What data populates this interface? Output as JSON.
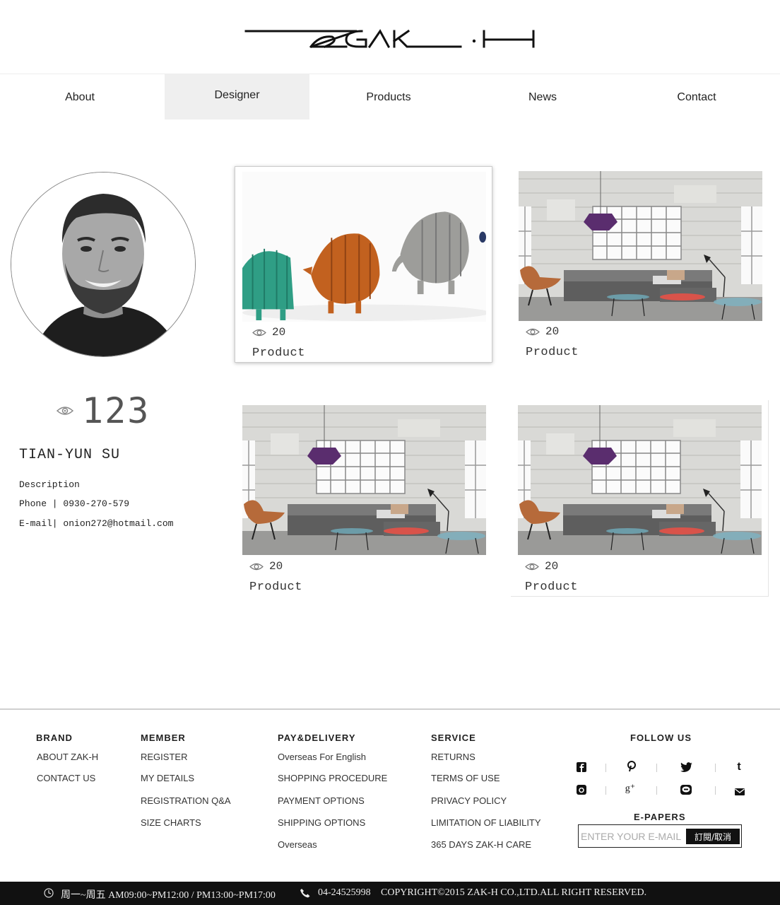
{
  "brand": {
    "logo_text": "ZAK-H"
  },
  "nav": {
    "items": [
      {
        "label": "About"
      },
      {
        "label": "Designer"
      },
      {
        "label": "Products"
      },
      {
        "label": "News"
      },
      {
        "label": "Contact"
      }
    ],
    "active": "Designer"
  },
  "designer": {
    "views": "123",
    "name": "TIAN-YUN SU",
    "description": "Description",
    "phone": "Phone | 0930-270-579",
    "email": "E-mail| onion272@hotmail.com"
  },
  "products": [
    {
      "views": "20",
      "label": "Product",
      "image": "animal-figures",
      "highlighted": true
    },
    {
      "views": "20",
      "label": "Product",
      "image": "living-room",
      "highlighted": false
    },
    {
      "views": "20",
      "label": "Product",
      "image": "living-room",
      "highlighted": false
    },
    {
      "views": "20",
      "label": "Product",
      "image": "living-room",
      "highlighted": false
    }
  ],
  "footer": {
    "brand": {
      "title": "BRAND",
      "links": [
        "ABOUT ZAK-H",
        "CONTACT US"
      ]
    },
    "member": {
      "title": "MEMBER",
      "links": [
        "REGISTER",
        "MY DETAILS",
        "REGISTRATION Q&A",
        "SIZE CHARTS"
      ]
    },
    "pay": {
      "title": "PAY&DELIVERY",
      "links": [
        "Overseas For English",
        "SHOPPING PROCEDURE",
        "PAYMENT OPTIONS",
        "SHIPPING OPTIONS",
        "Overseas"
      ]
    },
    "service": {
      "title": "SERVICE",
      "links": [
        "RETURNS",
        "TERMS OF USE",
        "PRIVACY POLICY",
        "LIMITATION OF LIABILITY",
        "365 DAYS ZAK-H CARE"
      ]
    },
    "follow": {
      "title": "FOLLOW US",
      "icons": [
        "facebook-icon",
        "pinterest-icon",
        "twitter-icon",
        "tumblr-icon",
        "instagram-icon",
        "google-plus-icon",
        "line-icon",
        "mail-icon"
      ]
    },
    "epapers": {
      "title": "E-PAPERS",
      "placeholder": "ENTER YOUR E-MAIL",
      "button": "訂閱/取消"
    }
  },
  "bottom_bar": {
    "hours": "周一~周五 AM09:00~PM12:00 / PM13:00~PM17:00",
    "phone": "04-24525998",
    "copyright": "COPYRIGHT©2015  ZAK-H  CO.,LTD.ALL RIGHT RESERVED."
  },
  "colors": {
    "nav_active_bg": "#efefef",
    "bottom_bar_bg": "#111111",
    "accent_purple": "#5a2d6e"
  }
}
